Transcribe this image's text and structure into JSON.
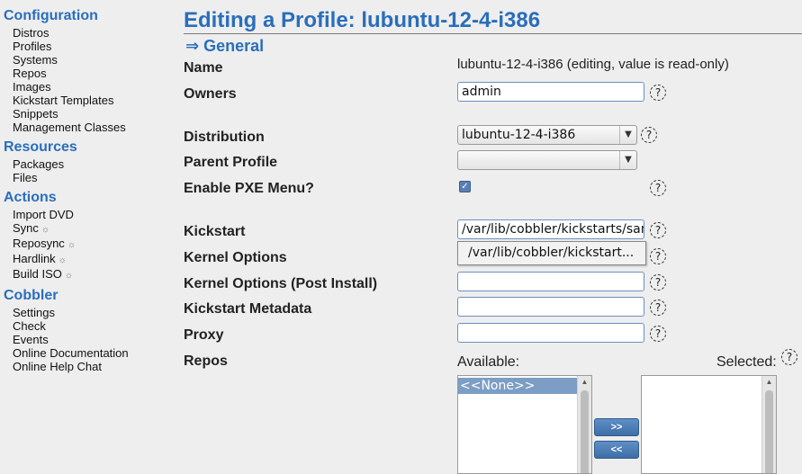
{
  "sidebar": {
    "sections": [
      {
        "title": "Configuration",
        "items": [
          "Distros",
          "Profiles",
          "Systems",
          "Repos",
          "Images",
          "Kickstart Templates",
          "Snippets",
          "Management Classes"
        ]
      },
      {
        "title": "Resources",
        "items": [
          "Packages",
          "Files"
        ]
      },
      {
        "title": "Actions",
        "items": [
          "Import DVD",
          "Sync",
          "Reposync",
          "Hardlink",
          "Build ISO"
        ]
      },
      {
        "title": "Cobbler",
        "items": [
          "Settings",
          "Check",
          "Events",
          "Online Documentation",
          "Online Help Chat"
        ]
      }
    ],
    "gear_icon": "☼"
  },
  "page": {
    "title": "Editing a Profile: lubuntu-12-4-i386",
    "section": "⇒ General"
  },
  "form": {
    "name_label": "Name",
    "name_value": "lubuntu-12-4-i386 (editing, value is read-only)",
    "owners_label": "Owners",
    "owners_value": "admin",
    "distribution_label": "Distribution",
    "distribution_value": "lubuntu-12-4-i386",
    "parent_label": "Parent Profile",
    "parent_value": "",
    "pxe_label": "Enable PXE Menu?",
    "pxe_checked": true,
    "kickstart_label": "Kickstart",
    "kickstart_value": "/var/lib/cobbler/kickstarts/sample.seed",
    "kickstart_tooltip": "/var/lib/cobbler/kickstart...",
    "kopts_label": "Kernel Options",
    "kopts_value": "",
    "kopts_post_label": "Kernel Options (Post Install)",
    "kopts_post_value": "",
    "ks_meta_label": "Kickstart Metadata",
    "ks_meta_value": "",
    "proxy_label": "Proxy",
    "proxy_value": "",
    "repos_label": "Repos",
    "available_label": "Available:",
    "selected_label": "Selected:",
    "available_options": [
      "<<None>>"
    ],
    "add_button": ">>",
    "remove_button": "<<",
    "help_glyph": "?"
  },
  "colors": {
    "accent": "#2a6ebb",
    "background": "#eeeeee"
  }
}
